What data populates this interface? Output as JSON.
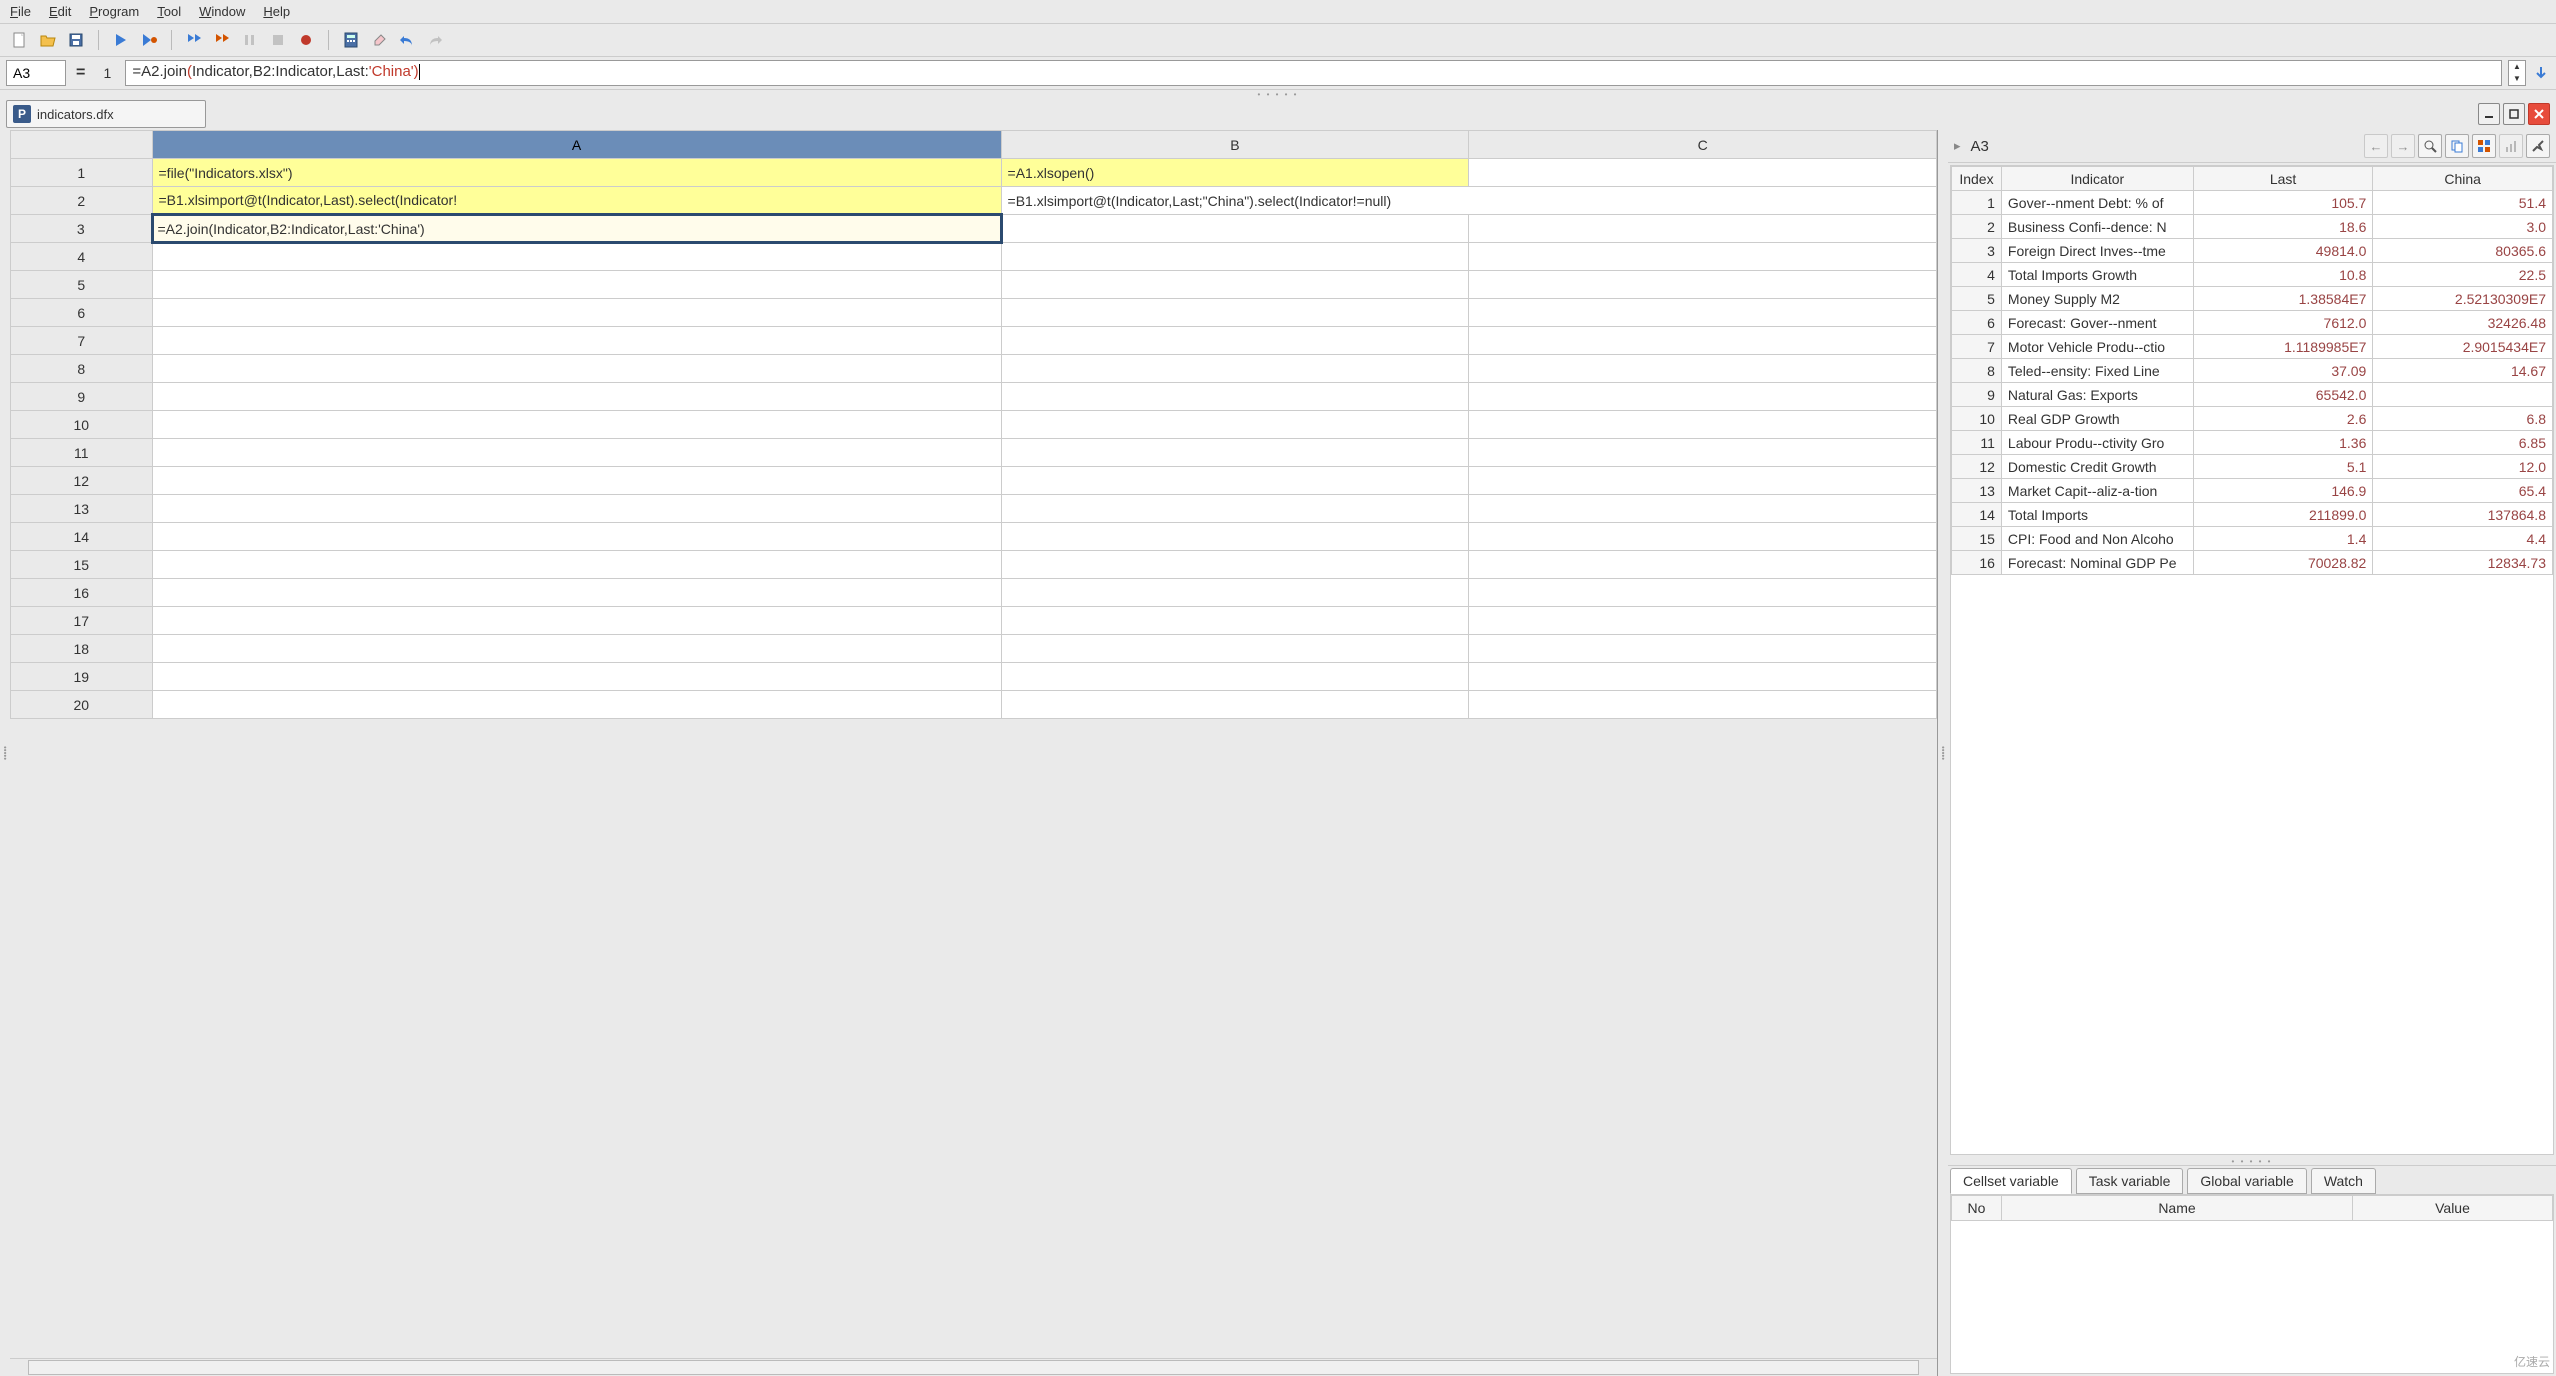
{
  "menu": {
    "file": "File",
    "edit": "Edit",
    "program": "Program",
    "tool": "Tool",
    "window": "Window",
    "help": "Help"
  },
  "formula_bar": {
    "cell_ref": "A3",
    "row_num": "1",
    "formula_prefix": "=A2.join",
    "formula_paren_open": "(",
    "formula_mid": "Indicator,B2:Indicator,Last:",
    "formula_str": "'China'",
    "formula_paren_close": ")"
  },
  "file_tab": "indicators.dfx",
  "grid": {
    "cols": [
      "A",
      "B",
      "C"
    ],
    "rows": [
      {
        "n": "1",
        "A": "=file(\"Indicators.xlsx\")",
        "B": "=A1.xlsopen()",
        "C": "",
        "hl": [
          "A",
          "B"
        ]
      },
      {
        "n": "2",
        "A": "=B1.xlsimport@t(Indicator,Last).select(Indicator!",
        "B": "=B1.xlsimport@t(Indicator,Last;\"China\").select(Indicator!=null)",
        "C": "",
        "hl": [
          "A"
        ]
      },
      {
        "n": "3",
        "A": "=A2.join(Indicator,B2:Indicator,Last:'China')",
        "B": "",
        "C": "",
        "sel": "A"
      },
      {
        "n": "4",
        "A": "",
        "B": "",
        "C": ""
      },
      {
        "n": "5",
        "A": "",
        "B": "",
        "C": ""
      },
      {
        "n": "6",
        "A": "",
        "B": "",
        "C": ""
      },
      {
        "n": "7",
        "A": "",
        "B": "",
        "C": ""
      },
      {
        "n": "8",
        "A": "",
        "B": "",
        "C": ""
      },
      {
        "n": "9",
        "A": "",
        "B": "",
        "C": ""
      },
      {
        "n": "10",
        "A": "",
        "B": "",
        "C": ""
      },
      {
        "n": "11",
        "A": "",
        "B": "",
        "C": ""
      },
      {
        "n": "12",
        "A": "",
        "B": "",
        "C": ""
      },
      {
        "n": "13",
        "A": "",
        "B": "",
        "C": ""
      },
      {
        "n": "14",
        "A": "",
        "B": "",
        "C": ""
      },
      {
        "n": "15",
        "A": "",
        "B": "",
        "C": ""
      },
      {
        "n": "16",
        "A": "",
        "B": "",
        "C": ""
      },
      {
        "n": "17",
        "A": "",
        "B": "",
        "C": ""
      },
      {
        "n": "18",
        "A": "",
        "B": "",
        "C": ""
      },
      {
        "n": "19",
        "A": "",
        "B": "",
        "C": ""
      },
      {
        "n": "20",
        "A": "",
        "B": "",
        "C": ""
      }
    ]
  },
  "result": {
    "cell_ref": "A3",
    "cols": [
      "Index",
      "Indicator",
      "Last",
      "China"
    ],
    "rows": [
      {
        "i": "1",
        "ind": "Gover--nment Debt: % of",
        "last": "105.7",
        "china": "51.4"
      },
      {
        "i": "2",
        "ind": "Business Confi--dence: N",
        "last": "18.6",
        "china": "3.0"
      },
      {
        "i": "3",
        "ind": "Foreign Direct Inves--tme",
        "last": "49814.0",
        "china": "80365.6"
      },
      {
        "i": "4",
        "ind": "Total Imports Growth",
        "last": "10.8",
        "china": "22.5"
      },
      {
        "i": "5",
        "ind": "Money Supply M2",
        "last": "1.38584E7",
        "china": "2.52130309E7"
      },
      {
        "i": "6",
        "ind": "Forecast: Gover--nment ",
        "last": "7612.0",
        "china": "32426.48"
      },
      {
        "i": "7",
        "ind": "Motor Vehicle Produ--ctio",
        "last": "1.1189985E7",
        "china": "2.9015434E7"
      },
      {
        "i": "8",
        "ind": "Teled--ensity: Fixed Line",
        "last": "37.09",
        "china": "14.67"
      },
      {
        "i": "9",
        "ind": "Natural Gas: Exports",
        "last": "65542.0",
        "china": ""
      },
      {
        "i": "10",
        "ind": "Real GDP Growth",
        "last": "2.6",
        "china": "6.8"
      },
      {
        "i": "11",
        "ind": "Labour Produ--ctivity Gro",
        "last": "1.36",
        "china": "6.85"
      },
      {
        "i": "12",
        "ind": "Domestic Credit Growth",
        "last": "5.1",
        "china": "12.0"
      },
      {
        "i": "13",
        "ind": "Market Capit--aliz-a-tion",
        "last": "146.9",
        "china": "65.4"
      },
      {
        "i": "14",
        "ind": "Total Imports",
        "last": "211899.0",
        "china": "137864.8"
      },
      {
        "i": "15",
        "ind": "CPI: Food and Non Alcoho",
        "last": "1.4",
        "china": "4.4"
      },
      {
        "i": "16",
        "ind": "Forecast: Nominal GDP Pe",
        "last": "70028.82",
        "china": "12834.73"
      }
    ]
  },
  "var_tabs": {
    "cellset": "Cellset variable",
    "task": "Task variable",
    "global": "Global variable",
    "watch": "Watch"
  },
  "var_cols": {
    "no": "No",
    "name": "Name",
    "value": "Value"
  },
  "watermark": "亿速云"
}
